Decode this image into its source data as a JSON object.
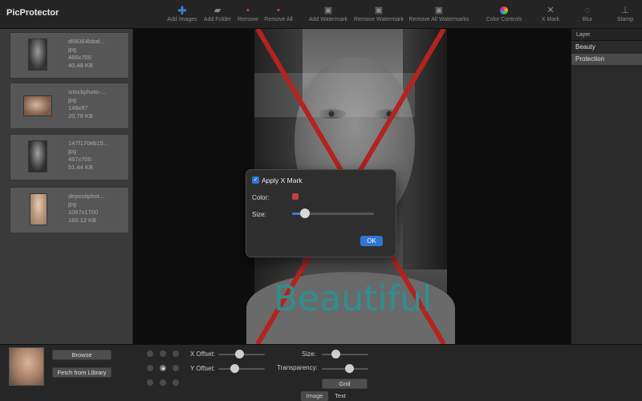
{
  "app": {
    "title": "PicProtector"
  },
  "toolbar": {
    "buttons": [
      {
        "label": "Add Images",
        "icon": "plus-icon"
      },
      {
        "label": "Add Folder",
        "icon": "folder-icon"
      },
      {
        "label": "Remove",
        "icon": "remove-icon"
      },
      {
        "label": "Remove All",
        "icon": "remove-all-icon"
      },
      {
        "label": "Add Watermark",
        "icon": "watermark-icon"
      },
      {
        "label": "Remove Watermark",
        "icon": "remove-watermark-icon"
      },
      {
        "label": "Remove All Watermarks",
        "icon": "remove-all-watermarks-icon"
      },
      {
        "label": "Color Controls",
        "icon": "color-wheel-icon"
      },
      {
        "label": "X Mark",
        "icon": "x-mark-icon"
      },
      {
        "label": "Blur",
        "icon": "blur-icon"
      },
      {
        "label": "Stamp",
        "icon": "stamp-icon"
      }
    ]
  },
  "images": [
    {
      "name": "d58364bbaf...",
      "type": "jpg",
      "dims": "466x700",
      "size": "40.48 KB"
    },
    {
      "name": "istockphoto-...",
      "type": "jpg",
      "dims": "148x97",
      "size": "20.78 KB"
    },
    {
      "name": "147f170eb15...",
      "type": "jpg",
      "dims": "467x700",
      "size": "51.44 KB"
    },
    {
      "name": "depositphot...",
      "type": "jpg",
      "dims": "1067x1700",
      "size": "160.12 KB"
    }
  ],
  "canvas": {
    "watermark_text": "Beautiful",
    "xmark_color": "#b3231f"
  },
  "dialog": {
    "apply_label": "Apply X Mark",
    "apply_checked": true,
    "color_label": "Color:",
    "color_value": "#c24040",
    "size_label": "Size:",
    "size_level": 0.16,
    "ok_label": "OK"
  },
  "layers": {
    "header": "Layer",
    "items": [
      "Beauty",
      "Protection"
    ],
    "selected": "Protection"
  },
  "bottom": {
    "browse_label": "Browse",
    "fetch_label": "Fetch from Library",
    "x_offset_label": "X Offset:",
    "y_offset_label": "Y Offset:",
    "size_label": "Size:",
    "transparency_label": "Transparency:",
    "grid_label": "Grid",
    "x_offset_level": 0.45,
    "y_offset_level": 0.35,
    "size_level": 0.3,
    "transparency_level": 0.6,
    "tabs": [
      "Image",
      "Text"
    ],
    "active_tab": "Image"
  }
}
